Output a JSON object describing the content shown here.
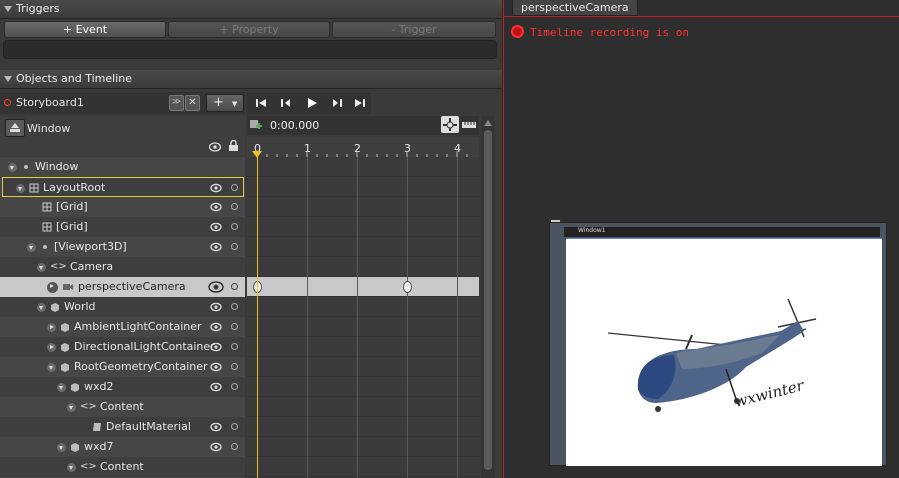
{
  "triggers": {
    "title": "Triggers",
    "buttons": [
      "+ Event",
      "+ Property",
      "- Trigger"
    ]
  },
  "objects": {
    "title": "Objects and Timeline",
    "storyboard": "Storyboard1",
    "scope": "Window",
    "time": "0:00.000",
    "ruler": [
      "0",
      "1",
      "2",
      "3",
      "4"
    ]
  },
  "tree": [
    {
      "label": "Window",
      "indent": 0,
      "icon": "window-icon"
    },
    {
      "label": "LayoutRoot",
      "indent": 1,
      "icon": "grid-icon"
    },
    {
      "label": "[Grid]",
      "indent": 3,
      "icon": "grid-icon"
    },
    {
      "label": "[Grid]",
      "indent": 3,
      "icon": "grid-icon"
    },
    {
      "label": "[Viewport3D]",
      "indent": 2,
      "icon": "viewport-icon"
    },
    {
      "label": "Camera",
      "indent": 3,
      "icon": "brackets-icon"
    },
    {
      "label": "perspectiveCamera",
      "indent": 4,
      "icon": "camera-icon"
    },
    {
      "label": "World",
      "indent": 3,
      "icon": "cube-icon"
    },
    {
      "label": "AmbientLightContainer",
      "indent": 4,
      "icon": "cube-icon"
    },
    {
      "label": "DirectionalLightContainer",
      "indent": 4,
      "icon": "cube-icon"
    },
    {
      "label": "RootGeometryContainer",
      "indent": 4,
      "icon": "cube-icon"
    },
    {
      "label": "wxd2",
      "indent": 5,
      "icon": "cube-icon"
    },
    {
      "label": "Content",
      "indent": 6,
      "icon": "brackets-icon"
    },
    {
      "label": "DefaultMaterial",
      "indent": 8,
      "icon": "material-icon"
    },
    {
      "label": "wxd7",
      "indent": 5,
      "icon": "cube-icon"
    },
    {
      "label": "Content",
      "indent": 6,
      "icon": "brackets-icon"
    }
  ],
  "right": {
    "tab": "perspectiveCamera",
    "recording": "Timeline recording is on",
    "preview_title": "Window1",
    "watermark": "wxwinter"
  },
  "colors": {
    "accent": "#e0d040",
    "record": "#ff3030"
  }
}
